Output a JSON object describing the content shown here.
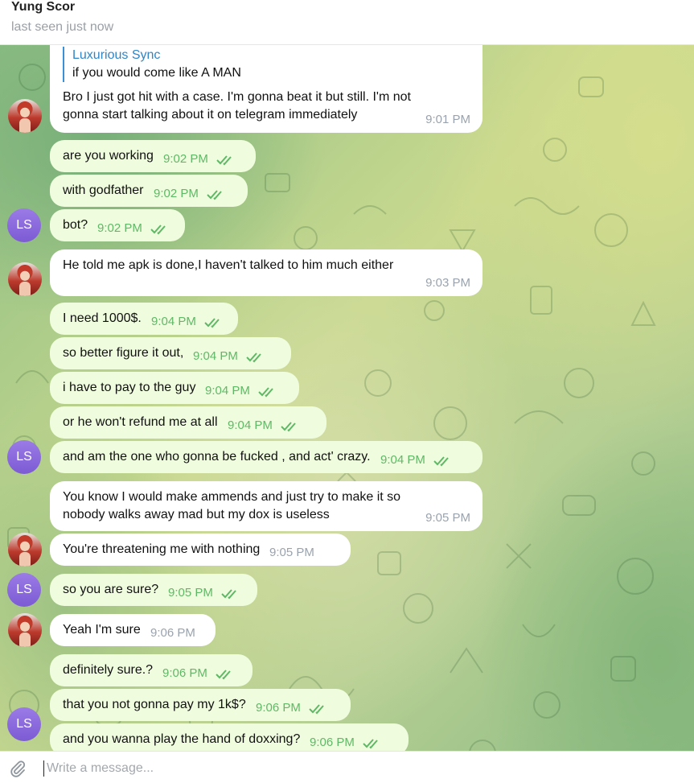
{
  "header": {
    "contact_name": "Yung Scor",
    "status": "last seen just now"
  },
  "avatars": {
    "ls_initials": "LS"
  },
  "reply": {
    "author": "Luxurious Sync",
    "text": "if you would come like A MAN"
  },
  "messages": [
    {
      "dir": "in",
      "lines": [
        "Bro I just got hit with a case. I'm gonna beat it but still. I'm not",
        "gonna start talking about it on telegram immediately"
      ],
      "time": "9:01 PM"
    },
    {
      "dir": "out",
      "lines": [
        "are you working"
      ],
      "time": "9:02 PM"
    },
    {
      "dir": "out",
      "lines": [
        "with godfather"
      ],
      "time": "9:02 PM"
    },
    {
      "dir": "out",
      "lines": [
        "bot?"
      ],
      "time": "9:02 PM"
    },
    {
      "dir": "in",
      "lines": [
        "He told me apk is done,I haven't talked to him much either"
      ],
      "time": "9:03 PM"
    },
    {
      "dir": "out",
      "lines": [
        "I need 1000$."
      ],
      "time": "9:04 PM"
    },
    {
      "dir": "out",
      "lines": [
        "so better figure it out,"
      ],
      "time": "9:04 PM"
    },
    {
      "dir": "out",
      "lines": [
        "i have to pay to the guy"
      ],
      "time": "9:04 PM"
    },
    {
      "dir": "out",
      "lines": [
        "or he won't refund me at all"
      ],
      "time": "9:04 PM"
    },
    {
      "dir": "out",
      "lines": [
        "and am the one who gonna be fucked , and act' crazy."
      ],
      "time": "9:04 PM"
    },
    {
      "dir": "in",
      "lines": [
        "You know I would make ammends and just try to make it so",
        "nobody walks away mad but my dox is useless"
      ],
      "time": "9:05 PM"
    },
    {
      "dir": "in",
      "lines": [
        "You're threatening me with nothing"
      ],
      "time": "9:05 PM"
    },
    {
      "dir": "out",
      "lines": [
        "so you are sure?"
      ],
      "time": "9:05 PM"
    },
    {
      "dir": "in",
      "lines": [
        "Yeah I'm sure"
      ],
      "time": "9:06 PM"
    },
    {
      "dir": "out",
      "lines": [
        "definitely sure.?"
      ],
      "time": "9:06 PM"
    },
    {
      "dir": "out",
      "lines": [
        "that you not gonna pay my 1k$?"
      ],
      "time": "9:06 PM"
    },
    {
      "dir": "out",
      "lines": [
        "and you wanna play the hand of doxxing?"
      ],
      "time": "9:06 PM"
    }
  ],
  "composer": {
    "placeholder": "Write a message..."
  },
  "colors": {
    "incoming": "#ffffff",
    "outgoing": "#effdde",
    "accent": "#3a8fd6",
    "check": "#5fb866",
    "avatar_ls": "#8a6ae0"
  }
}
